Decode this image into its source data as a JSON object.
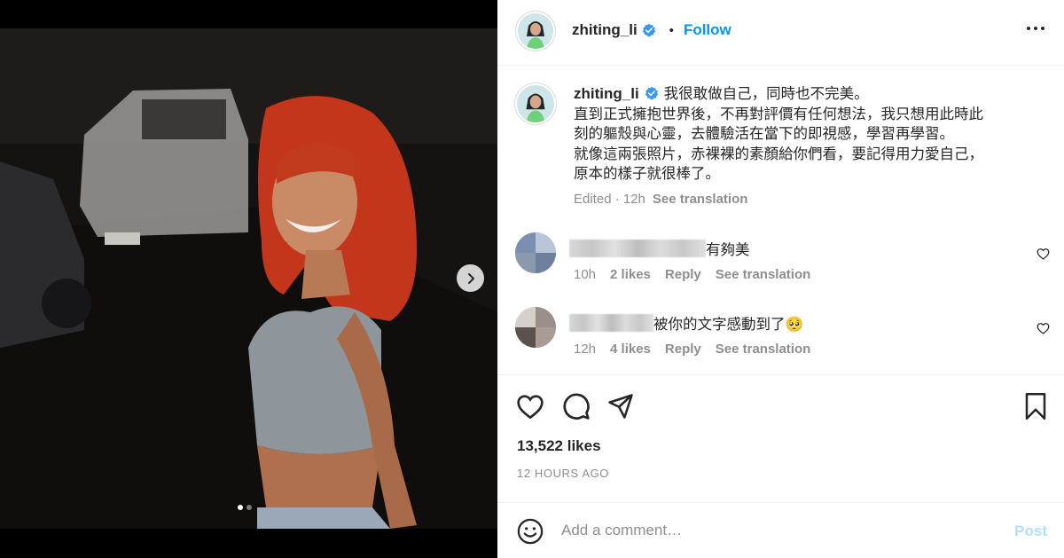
{
  "post": {
    "username": "zhiting_li",
    "follow_label": "Follow",
    "caption_lines": [
      "我很敢做自己，同時也不完美。",
      "直到正式擁抱世界後，不再對評價有任何想法，我只想用此時此",
      "刻的軀殼與心靈，去體驗活在當下的即視感，學習再學習。",
      "就像這兩張照片，赤裸裸的素顏給你們看，要記得用力愛自己，",
      "原本的樣子就很棒了。"
    ],
    "caption_meta": {
      "edited": "Edited · 12h",
      "translate": "See translation"
    },
    "likes": "13,522 likes",
    "time": "12 HOURS AGO",
    "carousel": {
      "count": 2,
      "active": 1
    }
  },
  "comments": [
    {
      "text": "有夠美",
      "age": "10h",
      "likes": "2 likes",
      "reply": "Reply",
      "translate": "See translation"
    },
    {
      "text": "被你的文字感動到了🥺",
      "age": "12h",
      "likes": "4 likes",
      "reply": "Reply",
      "translate": "See translation"
    }
  ],
  "composer": {
    "placeholder": "Add a comment…",
    "post_label": "Post"
  },
  "icons": [
    "chevron-right-icon",
    "verified-badge-icon",
    "more-options-icon",
    "heart-icon",
    "comment-icon",
    "share-icon",
    "bookmark-icon",
    "emoji-icon"
  ],
  "colors": {
    "accent": "#0095f6",
    "verified": "#3897f0",
    "post_disabled": "#b2dffc",
    "muted": "#8e8e8e",
    "text": "#262626"
  }
}
